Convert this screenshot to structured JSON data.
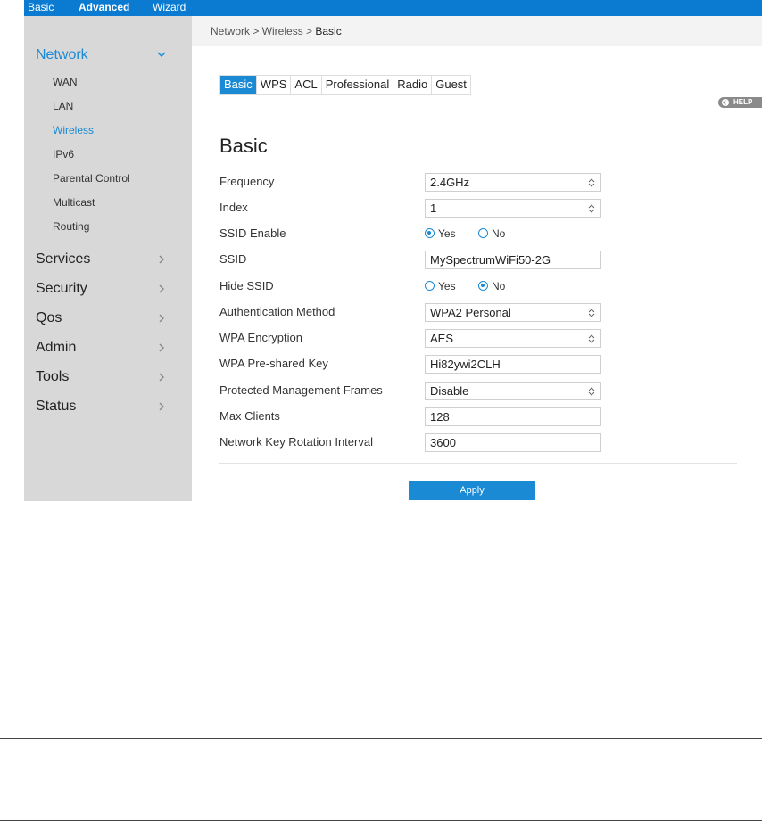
{
  "topnav": [
    "Basic",
    "Advanced",
    "Wizard"
  ],
  "breadcrumb": {
    "path": "Network > Wireless > ",
    "current": "Basic"
  },
  "sidebar": {
    "network": "Network",
    "subitems": [
      "WAN",
      "LAN",
      "Wireless",
      "IPv6",
      "Parental Control",
      "Multicast",
      "Routing"
    ],
    "sections": [
      "Services",
      "Security",
      "Qos",
      "Admin",
      "Tools",
      "Status"
    ]
  },
  "subtabs": [
    "Basic",
    "WPS",
    "ACL",
    "Professional",
    "Radio",
    "Guest"
  ],
  "help": "HELP",
  "title": "Basic",
  "form": {
    "frequency": {
      "label": "Frequency",
      "value": "2.4GHz"
    },
    "index": {
      "label": "Index",
      "value": "1"
    },
    "ssid_enable": {
      "label": "SSID Enable",
      "yes": "Yes",
      "no": "No",
      "selected": "Yes"
    },
    "ssid": {
      "label": "SSID",
      "value": "MySpectrumWiFi50-2G"
    },
    "hide_ssid": {
      "label": "Hide SSID",
      "yes": "Yes",
      "no": "No",
      "selected": "No"
    },
    "auth_method": {
      "label": "Authentication Method",
      "value": "WPA2 Personal"
    },
    "wpa_encryption": {
      "label": "WPA Encryption",
      "value": "AES"
    },
    "psk": {
      "label": "WPA Pre-shared Key",
      "value": "Hi82ywi2CLH"
    },
    "pmf": {
      "label": "Protected Management Frames",
      "value": "Disable"
    },
    "max_clients": {
      "label": "Max Clients",
      "value": "128"
    },
    "key_rotation": {
      "label": "Network Key Rotation Interval",
      "value": "3600"
    }
  },
  "apply_label": "Apply",
  "colors": {
    "accent": "#1a8ad4",
    "topbar": "#0a7bd0",
    "sidebar": "#d8d8d8"
  }
}
